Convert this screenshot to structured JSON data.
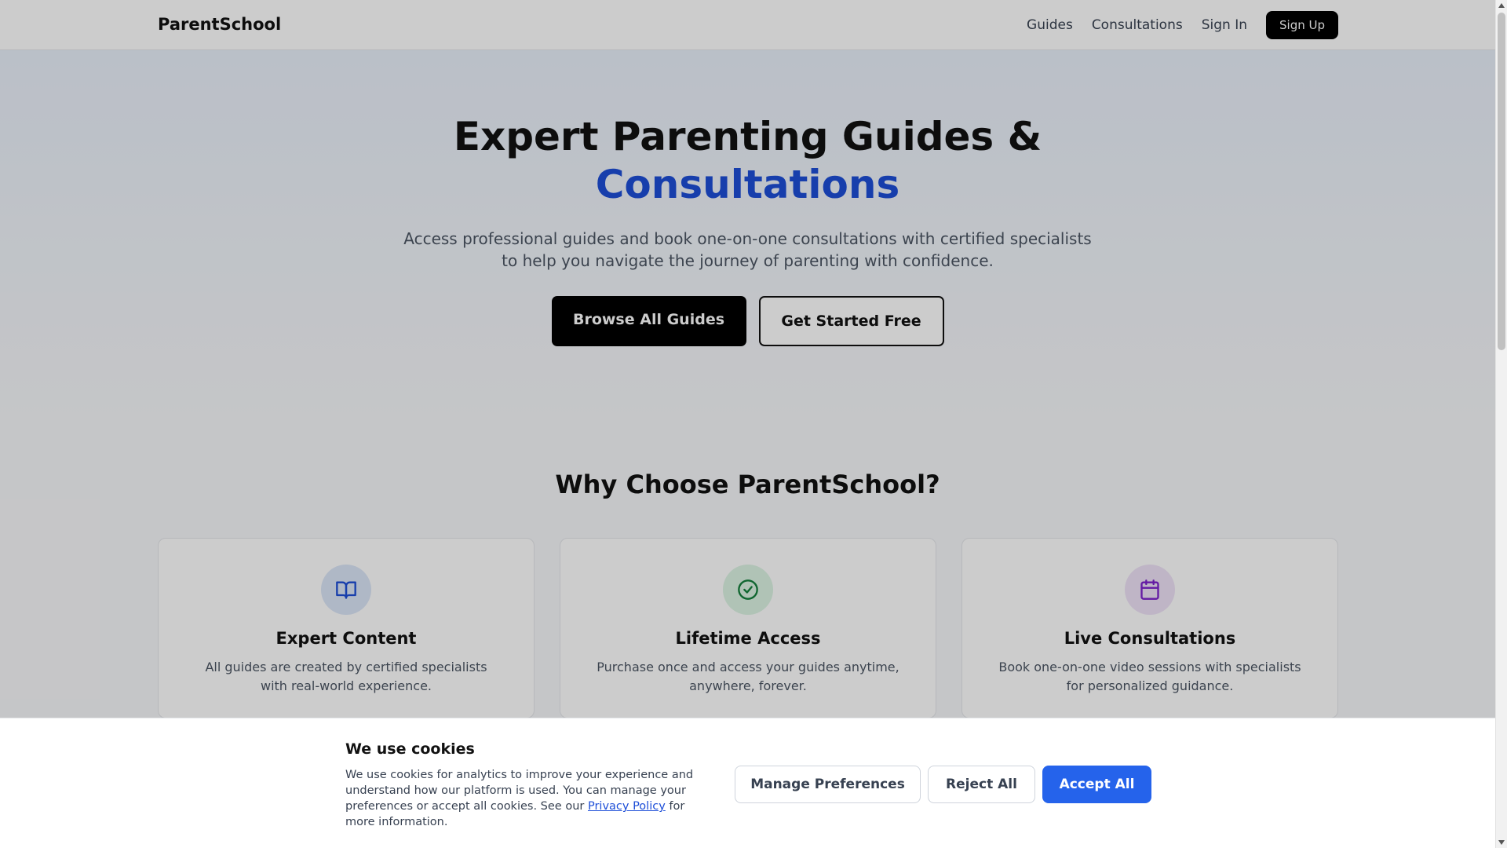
{
  "nav": {
    "brand": "ParentSchool",
    "links": [
      "Guides",
      "Consultations",
      "Sign In"
    ],
    "signup_label": "Sign Up"
  },
  "hero": {
    "title_line1": "Expert Parenting Guides &",
    "title_line2": "Consultations",
    "subtitle": "Access professional guides and book one-on-one consultations with certified specialists to help you navigate the journey of parenting with confidence.",
    "browse_label": "Browse All Guides",
    "start_label": "Get Started Free"
  },
  "why": {
    "title": "Why Choose ParentSchool?",
    "cards": [
      {
        "icon": "book-open-icon",
        "title": "Expert Content",
        "desc": "All guides are created by certified specialists with real-world experience.",
        "icon_bg": "#dbe6f8",
        "icon_color": "#1d4ed8"
      },
      {
        "icon": "check-circle-icon",
        "title": "Lifetime Access",
        "desc": "Purchase once and access your guides anytime, anywhere, forever.",
        "icon_bg": "#dcf4e4",
        "icon_color": "#15803d"
      },
      {
        "icon": "calendar-icon",
        "title": "Live Consultations",
        "desc": "Book one-on-one video sessions with specialists for personalized guidance.",
        "icon_bg": "#efe3f8",
        "icon_color": "#7e22ce"
      }
    ]
  },
  "cookie": {
    "title": "We use cookies",
    "text_before": "We use cookies for analytics to improve your experience and understand how our platform is used. You can manage your preferences or accept all cookies. See our ",
    "link": "Privacy Policy",
    "text_after": " for more information.",
    "manage_label": "Manage Preferences",
    "reject_label": "Reject All",
    "accept_label": "Accept All"
  },
  "colors": {
    "accent": "#1d4ed8",
    "accept_button": "#2563eb",
    "primary_button": "#000000"
  }
}
